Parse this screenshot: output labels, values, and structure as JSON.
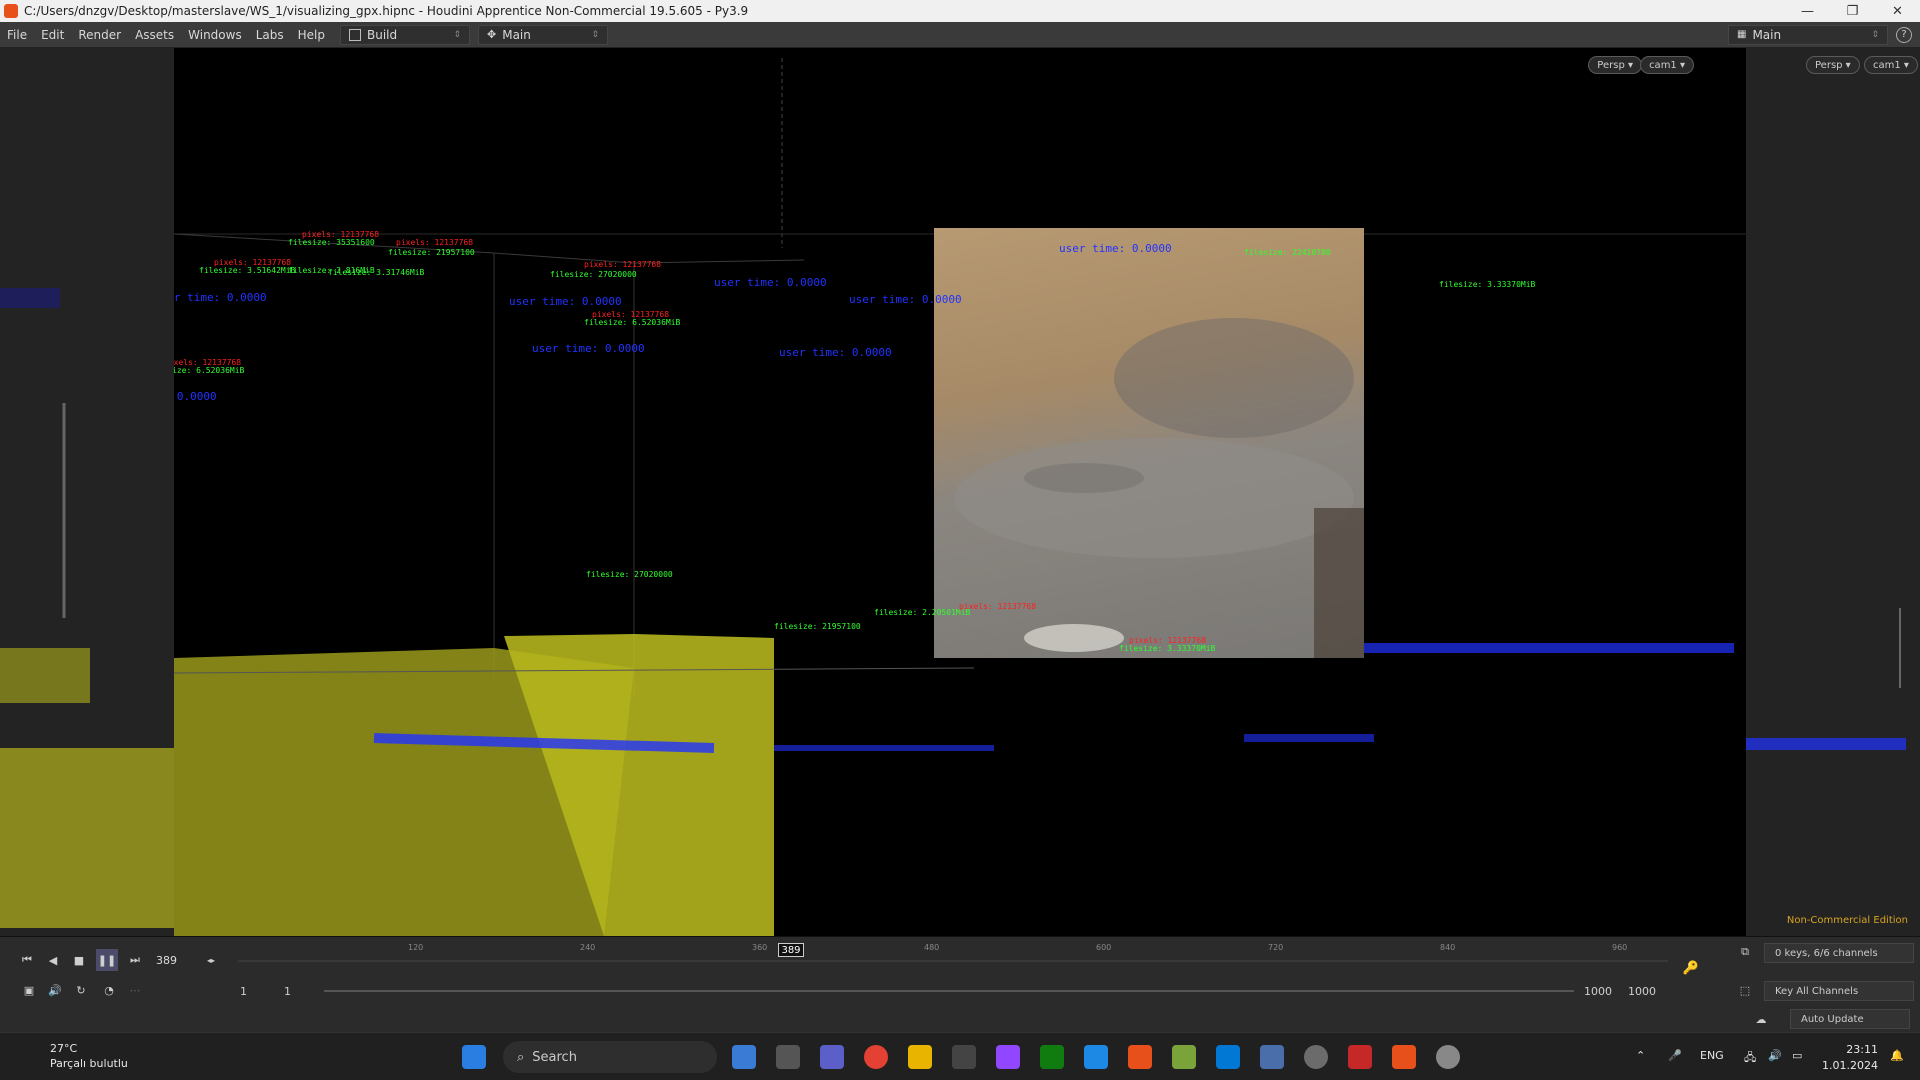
{
  "window": {
    "title": "C:/Users/dnzgv/Desktop/masterslave/WS_1/visualizing_gpx.hipnc - Houdini Apprentice Non-Commercial 19.5.605 - Py3.9",
    "minimize": "—",
    "maximize": "❐",
    "close": "✕"
  },
  "menu": {
    "items": [
      "File",
      "Edit",
      "Render",
      "Assets",
      "Windows",
      "Labs",
      "Help"
    ],
    "desktop_build": "Build",
    "desktop_main": "Main",
    "right_desktop": "Main"
  },
  "viewport": {
    "persp": "Persp ▾",
    "cam": "cam1 ▾",
    "edition": "Non-Commercial Edition",
    "labels_red": [
      "pixels: 12137768",
      "pixels: 12137768",
      "pixels: 12137768",
      "pixels: 12137768",
      "pixels: 12137768",
      "pixels: 12137768",
      "pixels: 12137768",
      "pixels: 12137768"
    ],
    "labels_green": [
      "filesize: 35351600",
      "filesize: 21957100",
      "filesize: 3.51642MiB",
      "filesize: 2.816MiB",
      "filesize: 3.31746MiB",
      "filesize: 27020000",
      "filesize: 6.52036MiB",
      "filesize: 6.52036MiB",
      "filesize: 22410700",
      "filesize: 3.33370MiB",
      "filesize: 27020000",
      "filesize: 21957100",
      "filesize: 3.33370MiB",
      "filesize: 2.20501MiB"
    ],
    "labels_blue": [
      "user time: 0.0000",
      "user time: 0.0000",
      "user time: 0.0000",
      "user time: 0.0000",
      "user time: 0.0000",
      "user time: 0.0000",
      "user time: 0.0000",
      "user time: 0.0000"
    ]
  },
  "timeline": {
    "current_frame": "389",
    "playhead": "389",
    "ticks": [
      "120",
      "240",
      "360",
      "480",
      "600",
      "720",
      "840",
      "960"
    ],
    "range_start": "1",
    "range_start2": "1",
    "range_end": "1000",
    "range_end2": "1000",
    "keys_info": "0 keys, 6/6 channels",
    "key_all": "Key All Channels",
    "auto_update": "Auto Update"
  },
  "taskbar": {
    "weather_temp": "27°C",
    "weather_desc": "Parçalı bulutlu",
    "search": "Search",
    "lang": "ENG",
    "time": "23:11",
    "date": "1.01.2024"
  },
  "colors": {
    "accent_orange": "#e8501b",
    "edition_gold": "#d8a520",
    "geo_yellow": "#b5b51e"
  }
}
